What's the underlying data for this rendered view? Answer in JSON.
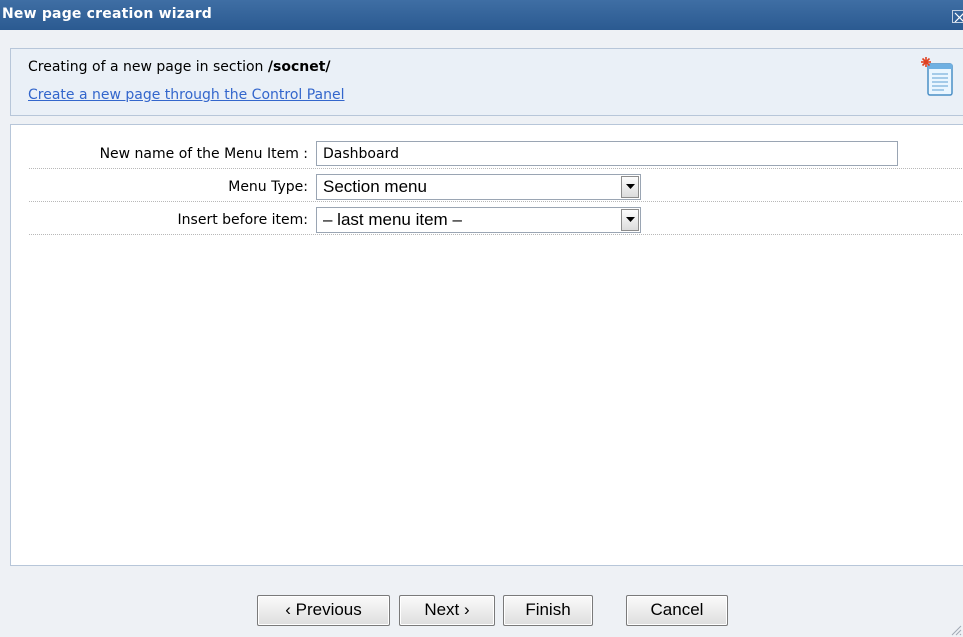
{
  "window": {
    "title": "New page creation wizard"
  },
  "header": {
    "intro_text": "Creating of a new page in section ",
    "section_path": "/socnet/",
    "control_panel_link": "Create a new page through the Control Panel"
  },
  "form": {
    "menu_item_name": {
      "label": "New name of the Menu Item :",
      "value": "Dashboard"
    },
    "menu_type": {
      "label": "Menu Type:",
      "selected": "Section menu"
    },
    "insert_before": {
      "label": "Insert before item:",
      "selected": "– last menu item –"
    }
  },
  "footer": {
    "previous_label": "‹ Previous",
    "next_label": "Next ›",
    "finish_label": "Finish",
    "cancel_label": "Cancel"
  },
  "icons": {
    "close": "close-icon",
    "new_page": "new-page-icon",
    "dropdown": "chevron-down-icon",
    "resize": "resize-grip-icon"
  },
  "colors": {
    "titlebar": "#2f5f97",
    "link": "#3366cc",
    "panel_border": "#b7c6d9",
    "background": "#eef1f5"
  }
}
